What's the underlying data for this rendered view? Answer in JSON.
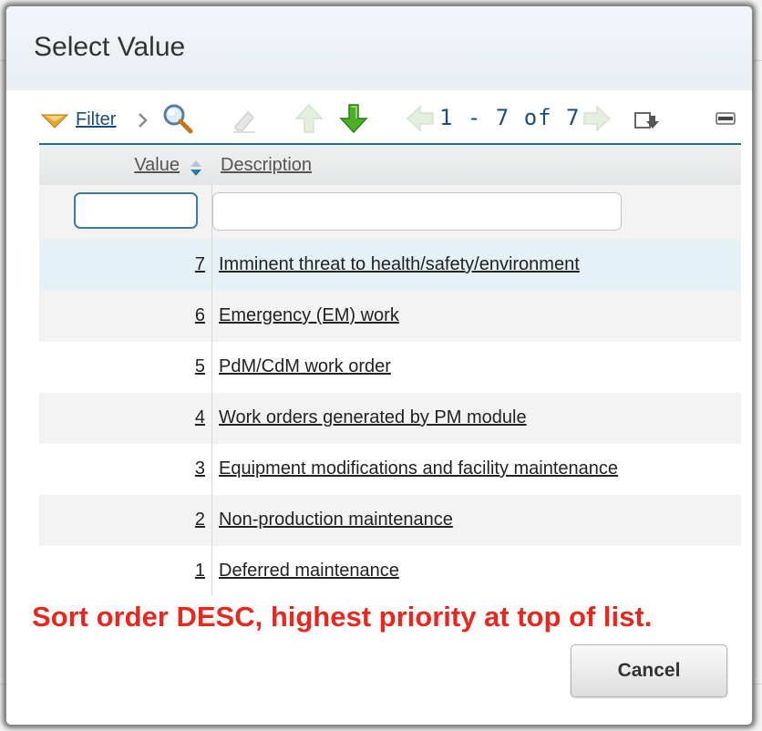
{
  "dialog": {
    "title": "Select Value"
  },
  "toolbar": {
    "filter_label": "Filter",
    "paging_text": "1 - 7 of 7"
  },
  "table": {
    "columns": [
      "Value",
      "Description"
    ],
    "filter_values": {
      "value": "",
      "description": ""
    },
    "rows": [
      {
        "value": "7",
        "description": "Imminent threat to health/safety/environment"
      },
      {
        "value": "6",
        "description": "Emergency (EM) work"
      },
      {
        "value": "5",
        "description": "PdM/CdM work order"
      },
      {
        "value": "4",
        "description": "Work orders generated by PM module"
      },
      {
        "value": "3",
        "description": "Equipment modifications and facility maintenance"
      },
      {
        "value": "2",
        "description": "Non-production maintenance"
      },
      {
        "value": "1",
        "description": "Deferred maintenance"
      }
    ]
  },
  "annotation": "Sort order DESC, highest priority at top of list.",
  "buttons": {
    "cancel": "Cancel"
  },
  "colors": {
    "link": "#1b4d7a",
    "accent_border": "#2a6b88",
    "selected_row": "#e4f2f7",
    "annotation": "#e8281e",
    "arrow_green": "#3c9a1e"
  }
}
